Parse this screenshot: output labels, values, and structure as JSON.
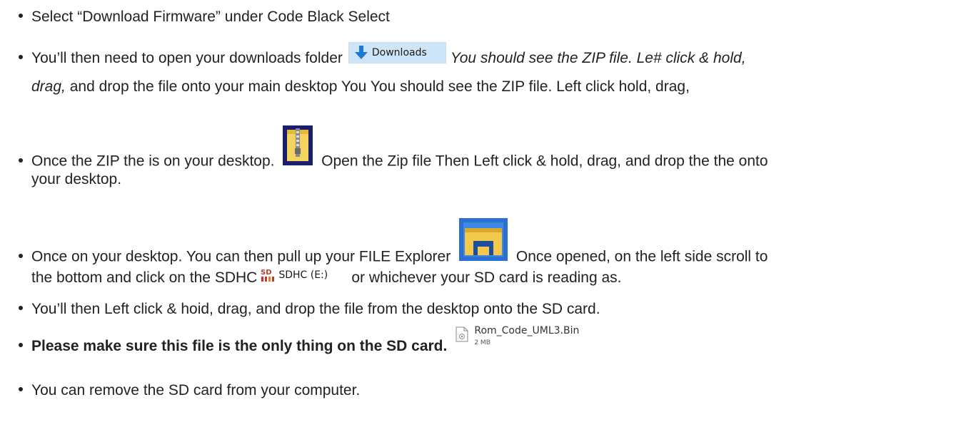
{
  "colors": {
    "text": "#222222",
    "downloads_bg": "#cde5f7",
    "arrow_blue": "#1e78d7",
    "zip_yellow": "#f4d35e",
    "explorer_blue": "#2b6fd1",
    "sd_red": "#c0392b"
  },
  "steps": [
    {
      "text": "Select “Download Firmware” under Code Black Select"
    },
    {
      "text_before": "You’ll then need to open your downloads folder",
      "button_label": "Downloads",
      "button_icon": "download-arrow-icon",
      "italic_text": "You should see the ZIP file. Le# click & hold,",
      "line2_italic": "drag,",
      "line2_text": "and drop the file onto your main desktop You You should see the ZIP file. Left click hold, drag,"
    },
    {
      "text_before": "Once the ZIP the is on your desktop.",
      "icon": "zip-folder-icon",
      "text_after": "Open the Zip file Then Left click & hold, drag, and drop the the onto",
      "line2_text": "your desktop."
    },
    {
      "text_before": "Once on your desktop. You can then pull up your FILE Explorer",
      "icon": "file-explorer-icon",
      "text_after": "Once opened, on the left side scroll to",
      "line2_text_before": "the bottom and click on the SDHC",
      "drive_label": "SDHC (E:)",
      "drive_icon": "sd-card-icon",
      "line2_text_after": "or whichever your SD card is reading as."
    },
    {
      "text": "You’ll then Left click & hoid, drag, and drop the file from the desktop onto the SD card."
    },
    {
      "text_bold": "Please make sure this file is the only thing on the SD card.",
      "file_name": "Rom_Code_UML3.Bin",
      "file_size": "2 MB",
      "file_icon": "bin-file-icon"
    },
    {
      "text": "You can remove the SD card from your computer."
    }
  ]
}
